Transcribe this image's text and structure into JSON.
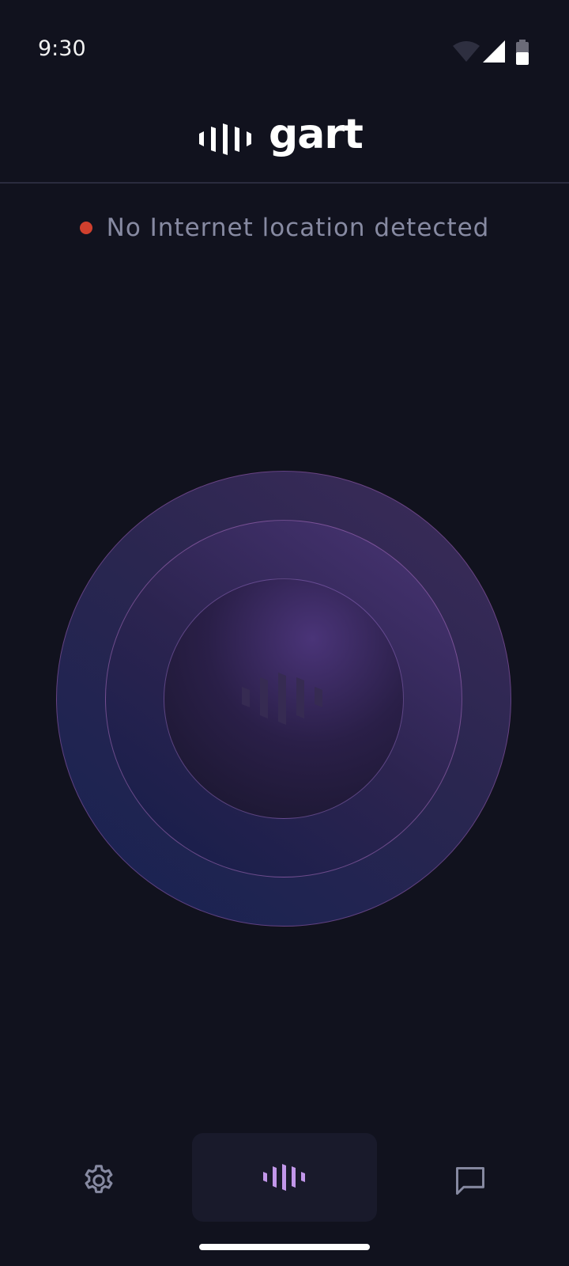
{
  "status_bar": {
    "time": "9:30",
    "icons": [
      "wifi-icon",
      "signal-icon",
      "battery-icon"
    ]
  },
  "header": {
    "logo_text": "gart",
    "logo_icon": "soundwave-logo-icon"
  },
  "connection": {
    "message": "No Internet location detected",
    "indicator_color": "#d0402e"
  },
  "orb": {
    "icon": "soundwave-icon",
    "colors": {
      "outer": "#172252",
      "middle": "#4a3575",
      "inner": "#17152a"
    }
  },
  "bottom_nav": {
    "items": [
      {
        "icon": "gear-icon",
        "active": false
      },
      {
        "icon": "soundwave-icon",
        "active": true
      },
      {
        "icon": "chat-icon",
        "active": false
      }
    ],
    "accent": "#c297ea"
  },
  "theme": {
    "background": "#11121e",
    "muted_text": "#878aa2"
  }
}
